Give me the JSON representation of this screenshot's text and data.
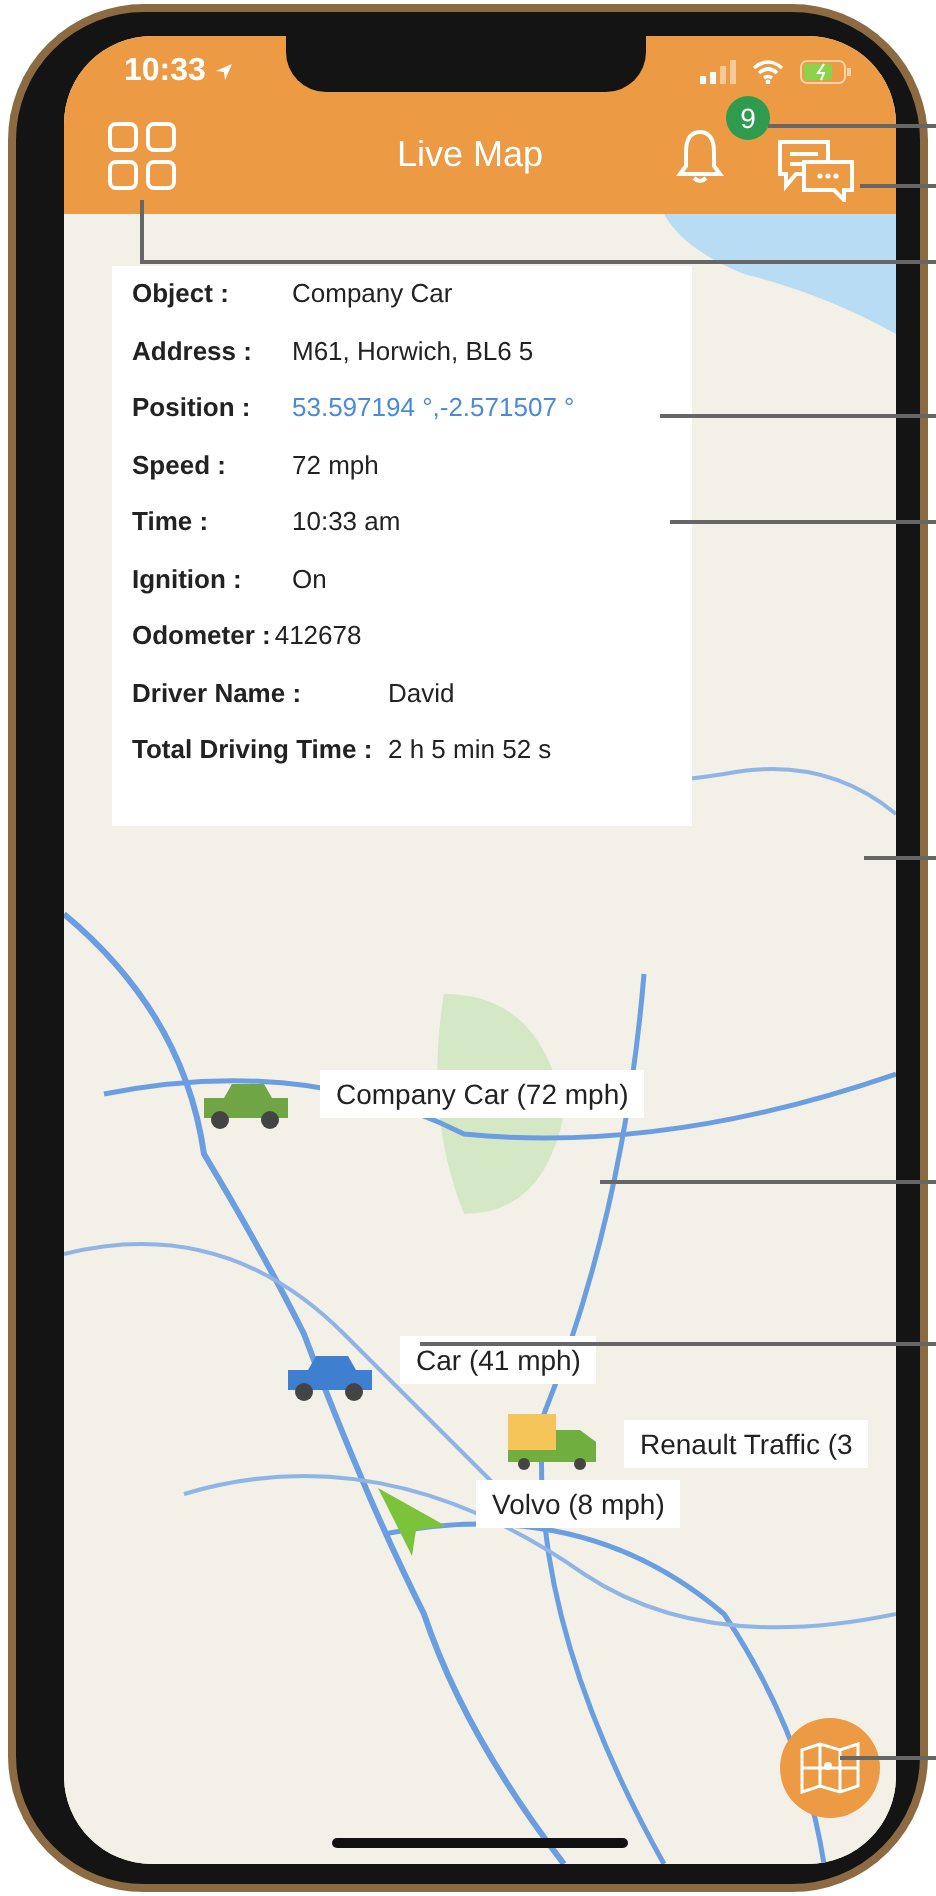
{
  "status_bar": {
    "time": "10:33"
  },
  "header": {
    "title": "Live Map",
    "notification_count": "9"
  },
  "info_card": {
    "rows": [
      {
        "label": "Object :",
        "value": "Company Car",
        "kind": "plain"
      },
      {
        "label": "Address :",
        "value": "M61, Horwich, BL6 5",
        "kind": "plain"
      },
      {
        "label": "Position :",
        "value": "53.597194 °,-2.571507 °",
        "kind": "link"
      },
      {
        "label": "Speed :",
        "value": "72 mph",
        "kind": "plain"
      },
      {
        "label": "Time :",
        "value": "10:33 am",
        "kind": "plain"
      },
      {
        "label": "Ignition :",
        "value": "On",
        "kind": "plain"
      },
      {
        "label": "Odometer :",
        "value": "412678",
        "kind": "tight"
      },
      {
        "label": "Driver Name :",
        "value": "David",
        "kind": "wide"
      },
      {
        "label": "Total Driving Time :",
        "value": "2 h 5 min 52 s",
        "kind": "wide"
      }
    ]
  },
  "vehicles": [
    {
      "label": "Company Car (72 mph)",
      "kind": "car",
      "color": "#6fa544"
    },
    {
      "label": "Car (41 mph)",
      "kind": "car",
      "color": "#3f7fcf"
    },
    {
      "label": "Renault Traffic  (3",
      "kind": "truck",
      "color": "#f5c55a"
    },
    {
      "label": "Volvo (8 mph)",
      "kind": "arrow",
      "color": "#7cc23a"
    }
  ]
}
